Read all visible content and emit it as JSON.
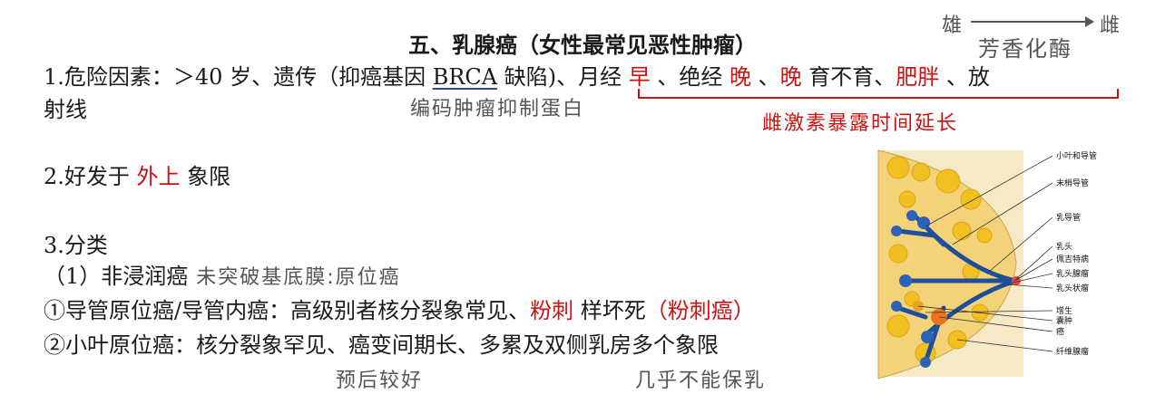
{
  "title": "五、乳腺癌（女性最常见恶性肿瘤）",
  "annotations_top": {
    "from": "雄",
    "to": "雌",
    "enzyme": "芳香化酶"
  },
  "risk": {
    "prefix": "1.危险因素：＞40 岁、遗传（抑癌基因 ",
    "gene": "BRCA",
    "mid": " 缺陷)、月经 ",
    "early": "早",
    "sep1": " 、绝经 ",
    "late1": "晚",
    "sep2": " 、",
    "late2": "晚",
    "mid2": " 育不育、",
    "fat": "肥胖",
    "suffix": " 、放",
    "line2": "射线",
    "note_gene": "编码肿瘤抑制蛋白",
    "note_estrogen": "雌激素暴露时间延长"
  },
  "site": {
    "prefix": "2.好发于 ",
    "quadrant": "外上",
    "suffix": " 象限"
  },
  "classification": {
    "heading": "3.分类",
    "sub1": "（1）非浸润癌",
    "sub1_note": " 未突破基底膜:原位癌",
    "item1_prefix": "①导管原位癌/导管内癌：高级别者核分裂象常见、",
    "item1_red": "粉刺",
    "item1_mid": "  样坏死",
    "item1_red2": "（粉刺癌）",
    "item2": "②小叶原位癌：核分裂象罕见、癌变间期长、多累及双侧乳房多个象限",
    "note_prognosis": "预后较好",
    "note_breast": "几乎不能保乳"
  },
  "diagram_labels": [
    "小叶和导管",
    "末梢导管",
    "乳导管",
    "乳头",
    "佩吉特病",
    "乳头腺瘤",
    "乳头状瘤",
    "增生",
    "囊肿",
    "癌",
    "纤维腺瘤"
  ]
}
